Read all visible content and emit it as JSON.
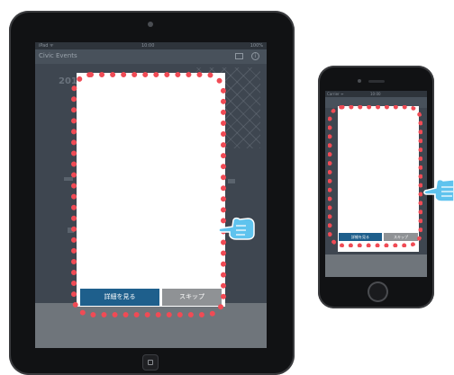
{
  "tablet": {
    "status": {
      "left": "iPad ᯤ",
      "time": "10:00",
      "right": "100%"
    },
    "app_title": "Civic Events",
    "background_year": "201",
    "popup": {
      "detail_button": "詳細を見る",
      "skip_button": "スキップ"
    }
  },
  "phone": {
    "status": {
      "left": "Carrier ᯤ",
      "time": "10:00"
    },
    "popup": {
      "detail_button": "詳細を見る",
      "skip_button": "スキップ"
    }
  },
  "colors": {
    "highlight": "#f04b55",
    "primary_button": "#1e5f8c",
    "secondary_button": "#8f9295",
    "hand": "#5fc3ee"
  },
  "icons": [
    "pointing-hand-icon",
    "mail-icon",
    "info-icon",
    "home-button-icon"
  ]
}
